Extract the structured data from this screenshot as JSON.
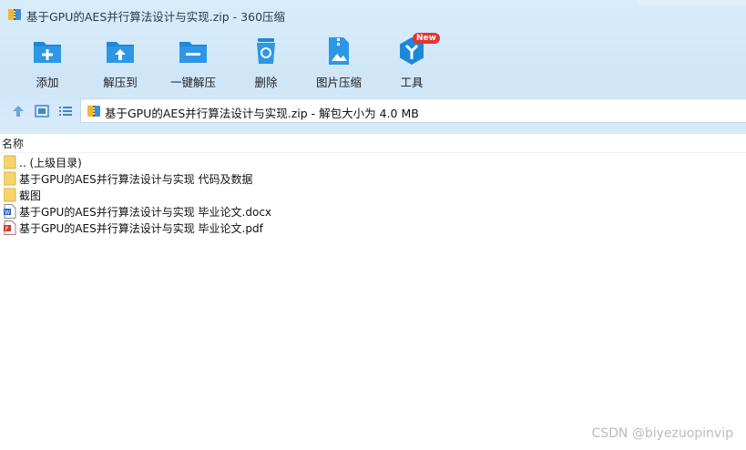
{
  "window": {
    "title": "基于GPU的AES并行算法设计与实现.zip - 360压缩"
  },
  "toolbar": {
    "items": [
      {
        "label": "添加",
        "icon": "add-icon"
      },
      {
        "label": "解压到",
        "icon": "extract-to-icon"
      },
      {
        "label": "一键解压",
        "icon": "one-click-extract-icon"
      },
      {
        "label": "删除",
        "icon": "delete-icon"
      },
      {
        "label": "图片压缩",
        "icon": "image-compress-icon"
      },
      {
        "label": "工具",
        "icon": "tools-icon",
        "badge": "New"
      }
    ]
  },
  "address": {
    "text": "基于GPU的AES并行算法设计与实现.zip - 解包大小为 4.0 MB"
  },
  "list": {
    "column_name": "名称",
    "files": [
      {
        "name": ".. (上级目录)",
        "type": "folder"
      },
      {
        "name": "基于GPU的AES并行算法设计与实现 代码及数据",
        "type": "folder"
      },
      {
        "name": "截图",
        "type": "folder"
      },
      {
        "name": "基于GPU的AES并行算法设计与实现 毕业论文.docx",
        "type": "docx"
      },
      {
        "name": "基于GPU的AES并行算法设计与实现 毕业论文.pdf",
        "type": "pdf"
      }
    ]
  },
  "watermark": "CSDN @biyezuopinvip",
  "colors": {
    "accent_blue": "#1e88d8",
    "toolbar_bg": "#d4e9fa",
    "badge_red": "#e8342e",
    "folder_yellow": "#f6d36b"
  }
}
